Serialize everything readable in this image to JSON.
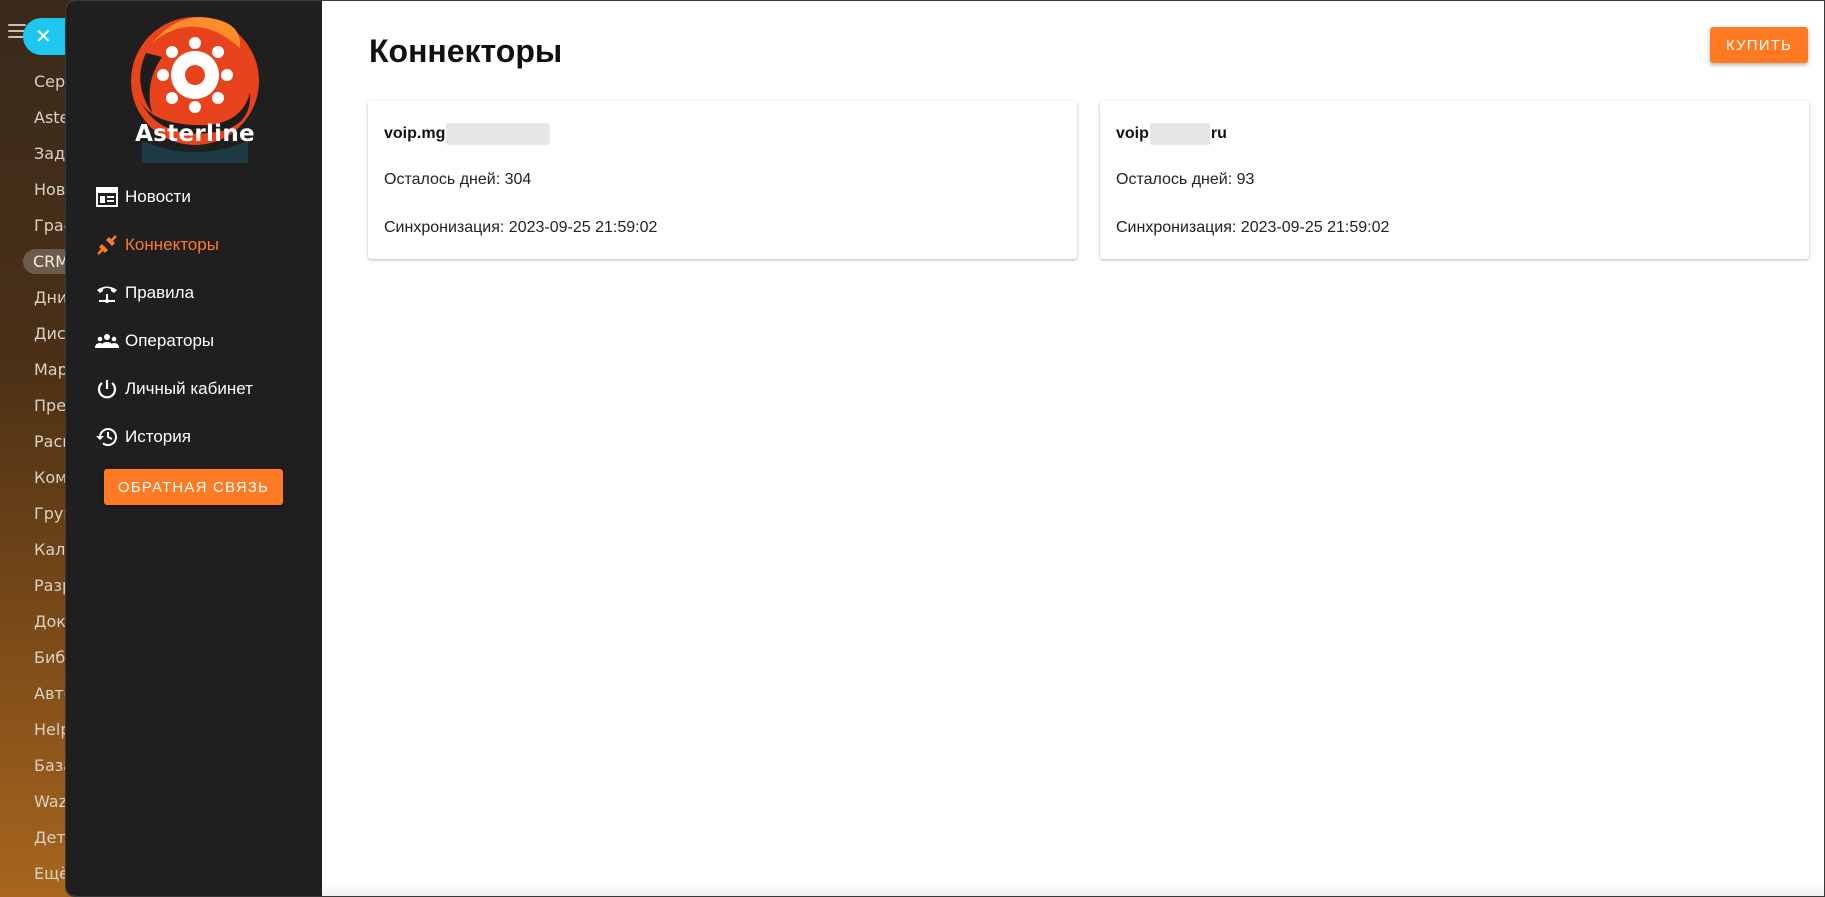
{
  "background_menu": {
    "items": [
      "Сере",
      "Aste",
      "Зада",
      "Ново",
      "Граф",
      "CRM",
      "Дни",
      "Диск",
      "Мар",
      "Прет",
      "Расп",
      "Ком",
      "Груп",
      "Кале",
      "Разр",
      "Доку",
      "Библ",
      "Авто",
      "Help",
      "База",
      "Waz",
      "Дета",
      "Ещё"
    ],
    "active_index": 5
  },
  "close_button": {
    "icon": "close-icon",
    "color": "#1ec6f0"
  },
  "sidebar": {
    "logo_text": "Asterline",
    "items": [
      {
        "label": "Новости",
        "icon": "news-icon"
      },
      {
        "label": "Коннекторы",
        "icon": "plug-icon",
        "active": true
      },
      {
        "label": "Правила",
        "icon": "phone-ip-icon"
      },
      {
        "label": "Операторы",
        "icon": "users-icon"
      },
      {
        "label": "Личный кабинет",
        "icon": "power-icon"
      },
      {
        "label": "История",
        "icon": "history-icon"
      }
    ],
    "feedback_label": "Обратная связь"
  },
  "main": {
    "title": "Коннекторы",
    "buy_label": "Купить",
    "connectors": [
      {
        "name_start": "voip.mg",
        "name_end": "",
        "days_left": "Осталось дней: 304",
        "sync": "Синхронизация: 2023-09-25 21:59:02"
      },
      {
        "name_start": "voip",
        "name_end": "ru",
        "days_left": "Осталось дней: 93",
        "sync": "Синхронизация: 2023-09-25 21:59:02"
      }
    ]
  },
  "colors": {
    "accent": "#ff7a22",
    "sidebar_bg": "#1f1f1f",
    "window_bg": "#ffffff"
  }
}
